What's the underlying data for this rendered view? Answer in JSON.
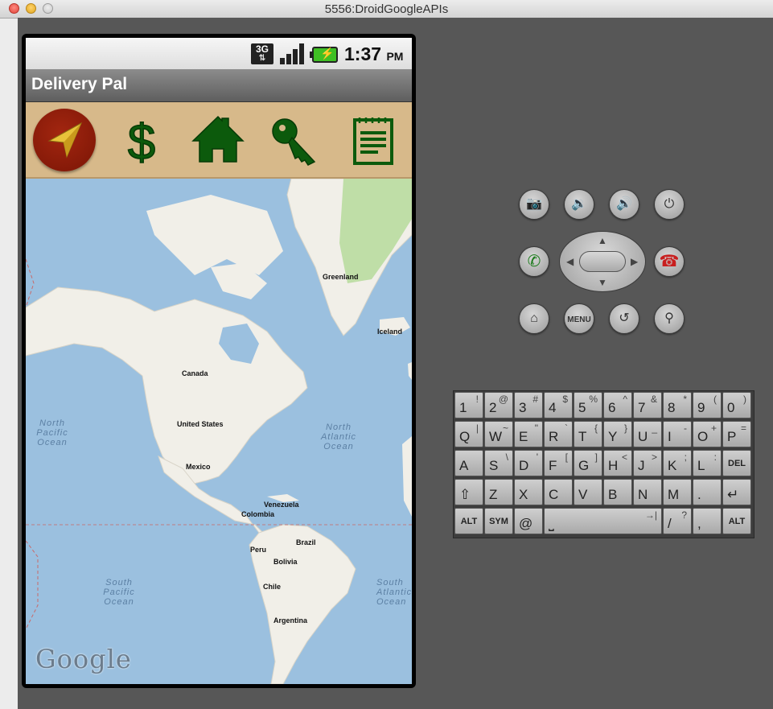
{
  "window": {
    "title": "5556:DroidGoogleAPIs"
  },
  "statusbar": {
    "network": "3G",
    "time": "1:37",
    "ampm": "PM"
  },
  "app": {
    "title": "Delivery Pal"
  },
  "toolbar": {
    "items": [
      {
        "icon": "navigation-arrow-icon"
      },
      {
        "icon": "dollar-icon"
      },
      {
        "icon": "home-icon"
      },
      {
        "icon": "key-icon"
      },
      {
        "icon": "notepad-icon"
      }
    ]
  },
  "map": {
    "labels": {
      "greenland": "Greenland",
      "iceland": "Iceland",
      "canada": "Canada",
      "united_states": "United States",
      "mexico": "Mexico",
      "venezuela": "Venezuela",
      "colombia": "Colombia",
      "brazil": "Brazil",
      "peru": "Peru",
      "bolivia": "Bolivia",
      "chile": "Chile",
      "argentina": "Argentina"
    },
    "oceans": {
      "north_pacific": "North Pacific Ocean",
      "north_atlantic": "North Atlantic Ocean",
      "south_pacific": "South Pacific Ocean",
      "south_atlantic": "South Atlantic Ocean"
    },
    "attribution": "Google"
  },
  "controls": {
    "row1": [
      "camera-icon",
      "volume-down-icon",
      "volume-up-icon",
      "power-icon"
    ],
    "row2": [
      "call-icon",
      "dpad",
      "end-call-icon"
    ],
    "row3": {
      "home": "home-icon",
      "menu": "MENU",
      "back": "back-icon",
      "search": "search-icon"
    }
  },
  "keyboard": {
    "row1": [
      {
        "main": "1",
        "alt": "!"
      },
      {
        "main": "2",
        "alt": "@"
      },
      {
        "main": "3",
        "alt": "#"
      },
      {
        "main": "4",
        "alt": "$"
      },
      {
        "main": "5",
        "alt": "%"
      },
      {
        "main": "6",
        "alt": "^"
      },
      {
        "main": "7",
        "alt": "&"
      },
      {
        "main": "8",
        "alt": "*"
      },
      {
        "main": "9",
        "alt": "("
      },
      {
        "main": "0",
        "alt": ")"
      }
    ],
    "row2": [
      {
        "main": "Q",
        "alt": "|"
      },
      {
        "main": "W",
        "alt": "~"
      },
      {
        "main": "E",
        "alt": "\""
      },
      {
        "main": "R",
        "alt": "`"
      },
      {
        "main": "T",
        "alt": "{"
      },
      {
        "main": "Y",
        "alt": "}"
      },
      {
        "main": "U",
        "alt": "_"
      },
      {
        "main": "I",
        "alt": "-"
      },
      {
        "main": "O",
        "alt": "+"
      },
      {
        "main": "P",
        "alt": "="
      }
    ],
    "row3": [
      {
        "main": "A",
        "alt": ""
      },
      {
        "main": "S",
        "alt": "\\"
      },
      {
        "main": "D",
        "alt": "'"
      },
      {
        "main": "F",
        "alt": "["
      },
      {
        "main": "G",
        "alt": "]"
      },
      {
        "main": "H",
        "alt": "<"
      },
      {
        "main": "J",
        "alt": ">"
      },
      {
        "main": "K",
        "alt": ";"
      },
      {
        "main": "L",
        "alt": ":"
      },
      {
        "main": "DEL",
        "alt": ""
      }
    ],
    "row4": [
      {
        "main": "⇧",
        "alt": ""
      },
      {
        "main": "Z",
        "alt": ""
      },
      {
        "main": "X",
        "alt": ""
      },
      {
        "main": "C",
        "alt": ""
      },
      {
        "main": "V",
        "alt": ""
      },
      {
        "main": "B",
        "alt": ""
      },
      {
        "main": "N",
        "alt": ""
      },
      {
        "main": "M",
        "alt": ""
      },
      {
        "main": ".",
        "alt": ""
      },
      {
        "main": "↵",
        "alt": ""
      }
    ],
    "row5": [
      {
        "main": "ALT",
        "alt": ""
      },
      {
        "main": "SYM",
        "alt": ""
      },
      {
        "main": "@",
        "alt": ""
      },
      {
        "main": "⎵",
        "alt": "→|"
      },
      {
        "main": "/",
        "alt": "?"
      },
      {
        "main": ",",
        "alt": ""
      },
      {
        "main": "ALT",
        "alt": ""
      }
    ]
  }
}
